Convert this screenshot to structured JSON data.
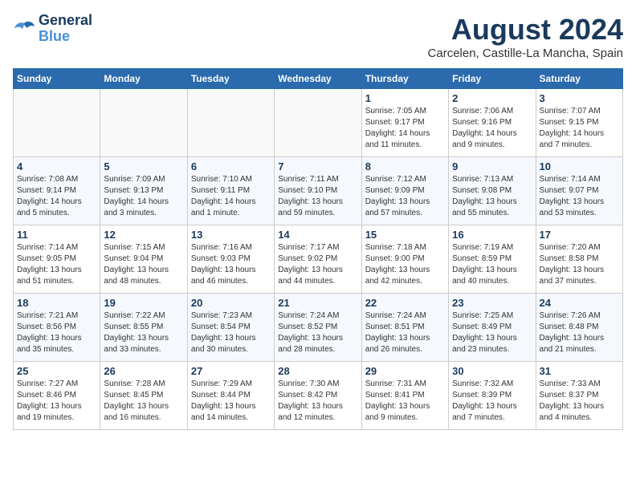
{
  "header": {
    "logo_line1": "General",
    "logo_line2": "Blue",
    "month_year": "August 2024",
    "location": "Carcelen, Castille-La Mancha, Spain"
  },
  "weekdays": [
    "Sunday",
    "Monday",
    "Tuesday",
    "Wednesday",
    "Thursday",
    "Friday",
    "Saturday"
  ],
  "weeks": [
    [
      {
        "day": "",
        "info": ""
      },
      {
        "day": "",
        "info": ""
      },
      {
        "day": "",
        "info": ""
      },
      {
        "day": "",
        "info": ""
      },
      {
        "day": "1",
        "info": "Sunrise: 7:05 AM\nSunset: 9:17 PM\nDaylight: 14 hours\nand 11 minutes."
      },
      {
        "day": "2",
        "info": "Sunrise: 7:06 AM\nSunset: 9:16 PM\nDaylight: 14 hours\nand 9 minutes."
      },
      {
        "day": "3",
        "info": "Sunrise: 7:07 AM\nSunset: 9:15 PM\nDaylight: 14 hours\nand 7 minutes."
      }
    ],
    [
      {
        "day": "4",
        "info": "Sunrise: 7:08 AM\nSunset: 9:14 PM\nDaylight: 14 hours\nand 5 minutes."
      },
      {
        "day": "5",
        "info": "Sunrise: 7:09 AM\nSunset: 9:13 PM\nDaylight: 14 hours\nand 3 minutes."
      },
      {
        "day": "6",
        "info": "Sunrise: 7:10 AM\nSunset: 9:11 PM\nDaylight: 14 hours\nand 1 minute."
      },
      {
        "day": "7",
        "info": "Sunrise: 7:11 AM\nSunset: 9:10 PM\nDaylight: 13 hours\nand 59 minutes."
      },
      {
        "day": "8",
        "info": "Sunrise: 7:12 AM\nSunset: 9:09 PM\nDaylight: 13 hours\nand 57 minutes."
      },
      {
        "day": "9",
        "info": "Sunrise: 7:13 AM\nSunset: 9:08 PM\nDaylight: 13 hours\nand 55 minutes."
      },
      {
        "day": "10",
        "info": "Sunrise: 7:14 AM\nSunset: 9:07 PM\nDaylight: 13 hours\nand 53 minutes."
      }
    ],
    [
      {
        "day": "11",
        "info": "Sunrise: 7:14 AM\nSunset: 9:05 PM\nDaylight: 13 hours\nand 51 minutes."
      },
      {
        "day": "12",
        "info": "Sunrise: 7:15 AM\nSunset: 9:04 PM\nDaylight: 13 hours\nand 48 minutes."
      },
      {
        "day": "13",
        "info": "Sunrise: 7:16 AM\nSunset: 9:03 PM\nDaylight: 13 hours\nand 46 minutes."
      },
      {
        "day": "14",
        "info": "Sunrise: 7:17 AM\nSunset: 9:02 PM\nDaylight: 13 hours\nand 44 minutes."
      },
      {
        "day": "15",
        "info": "Sunrise: 7:18 AM\nSunset: 9:00 PM\nDaylight: 13 hours\nand 42 minutes."
      },
      {
        "day": "16",
        "info": "Sunrise: 7:19 AM\nSunset: 8:59 PM\nDaylight: 13 hours\nand 40 minutes."
      },
      {
        "day": "17",
        "info": "Sunrise: 7:20 AM\nSunset: 8:58 PM\nDaylight: 13 hours\nand 37 minutes."
      }
    ],
    [
      {
        "day": "18",
        "info": "Sunrise: 7:21 AM\nSunset: 8:56 PM\nDaylight: 13 hours\nand 35 minutes."
      },
      {
        "day": "19",
        "info": "Sunrise: 7:22 AM\nSunset: 8:55 PM\nDaylight: 13 hours\nand 33 minutes."
      },
      {
        "day": "20",
        "info": "Sunrise: 7:23 AM\nSunset: 8:54 PM\nDaylight: 13 hours\nand 30 minutes."
      },
      {
        "day": "21",
        "info": "Sunrise: 7:24 AM\nSunset: 8:52 PM\nDaylight: 13 hours\nand 28 minutes."
      },
      {
        "day": "22",
        "info": "Sunrise: 7:24 AM\nSunset: 8:51 PM\nDaylight: 13 hours\nand 26 minutes."
      },
      {
        "day": "23",
        "info": "Sunrise: 7:25 AM\nSunset: 8:49 PM\nDaylight: 13 hours\nand 23 minutes."
      },
      {
        "day": "24",
        "info": "Sunrise: 7:26 AM\nSunset: 8:48 PM\nDaylight: 13 hours\nand 21 minutes."
      }
    ],
    [
      {
        "day": "25",
        "info": "Sunrise: 7:27 AM\nSunset: 8:46 PM\nDaylight: 13 hours\nand 19 minutes."
      },
      {
        "day": "26",
        "info": "Sunrise: 7:28 AM\nSunset: 8:45 PM\nDaylight: 13 hours\nand 16 minutes."
      },
      {
        "day": "27",
        "info": "Sunrise: 7:29 AM\nSunset: 8:44 PM\nDaylight: 13 hours\nand 14 minutes."
      },
      {
        "day": "28",
        "info": "Sunrise: 7:30 AM\nSunset: 8:42 PM\nDaylight: 13 hours\nand 12 minutes."
      },
      {
        "day": "29",
        "info": "Sunrise: 7:31 AM\nSunset: 8:41 PM\nDaylight: 13 hours\nand 9 minutes."
      },
      {
        "day": "30",
        "info": "Sunrise: 7:32 AM\nSunset: 8:39 PM\nDaylight: 13 hours\nand 7 minutes."
      },
      {
        "day": "31",
        "info": "Sunrise: 7:33 AM\nSunset: 8:37 PM\nDaylight: 13 hours\nand 4 minutes."
      }
    ]
  ]
}
